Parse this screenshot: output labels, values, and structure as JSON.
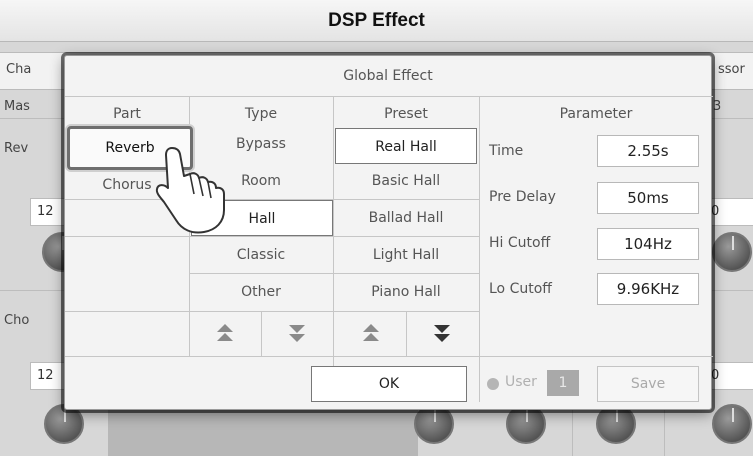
{
  "screen": {
    "title": "DSP Effect",
    "left_tab": "Cha",
    "right_tab": "ssor",
    "left_sub": "Mas",
    "right_sub": "3",
    "row1_label": "Rev",
    "row1_value": "12",
    "row1_right_value": "0",
    "row2_label": "Cho",
    "row2_value": "12",
    "row2_right_value": "0"
  },
  "dialog": {
    "title": "Global Effect",
    "headers": {
      "part": "Part",
      "type": "Type",
      "preset": "Preset",
      "parameter": "Parameter"
    },
    "parts": [
      {
        "label": "Reverb",
        "selected": true
      },
      {
        "label": "Chorus",
        "selected": false
      }
    ],
    "types": [
      {
        "label": "Bypass",
        "selected": false
      },
      {
        "label": "Room",
        "selected": false
      },
      {
        "label": "Hall",
        "selected": true
      },
      {
        "label": "Classic",
        "selected": false
      },
      {
        "label": "Other",
        "selected": false
      }
    ],
    "presets": [
      {
        "label": "Real Hall",
        "selected": true
      },
      {
        "label": "Basic Hall",
        "selected": false
      },
      {
        "label": "Ballad Hall",
        "selected": false
      },
      {
        "label": "Light Hall",
        "selected": false
      },
      {
        "label": "Piano Hall",
        "selected": false
      }
    ],
    "parameters": [
      {
        "label": "Time",
        "value": "2.55s"
      },
      {
        "label": "Pre Delay",
        "value": "50ms"
      },
      {
        "label": "Hi Cutoff",
        "value": "104Hz"
      },
      {
        "label": "Lo Cutoff",
        "value": "9.96KHz"
      }
    ],
    "icons": {
      "type_up": "double-chevron-up-icon",
      "type_down": "double-chevron-down-icon",
      "preset_up": "double-chevron-up-icon",
      "preset_down": "double-chevron-down-icon",
      "pointer": "hand-pointer-icon"
    },
    "ok_label": "OK",
    "user_label": "User",
    "user_number": "1",
    "save_label": "Save"
  }
}
